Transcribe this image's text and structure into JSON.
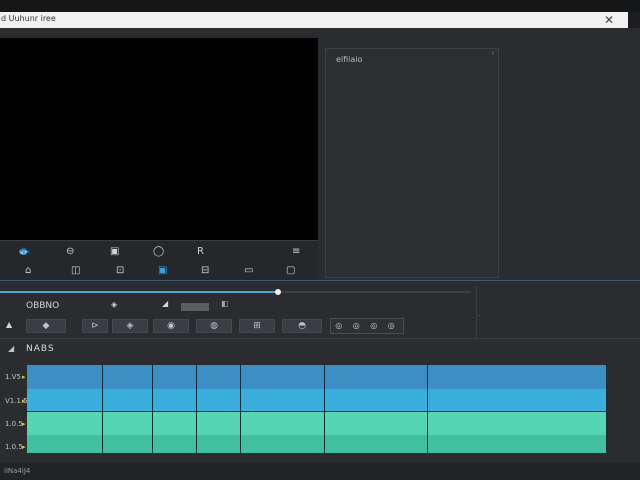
{
  "window": {
    "title": "d Uuhunr iree",
    "close_glyph": "✕"
  },
  "preview_controls": {
    "row1": [
      "🐟",
      "⊖",
      "▣",
      "◯",
      "R",
      "≡"
    ],
    "row2": [
      "⌂",
      "◫",
      "⊡",
      "▣",
      "⊟",
      "▭",
      "▢"
    ]
  },
  "props_panel": {
    "label": "eifiiaio",
    "corner_glyph": "ˀ"
  },
  "playback": {
    "progress_percent": 59
  },
  "toolbar": {
    "label": "OBBNO",
    "chip_glyph": "◈",
    "cursor_glyph": "◢",
    "chip2_glyph": "◧",
    "left_glyph": "▲"
  },
  "effects": [
    "◆",
    "⊳",
    "◈",
    "◉",
    "◍",
    "⊞",
    "◓"
  ],
  "effect_group": "◎ ◎ ◎ ◎",
  "timeline": {
    "icon": "◢",
    "label": "NABS",
    "tracks": [
      {
        "label": "1.V5",
        "color": "#3b8fc4"
      },
      {
        "label": "V1.1.5",
        "color": "#3aaedd"
      },
      {
        "label": "1.0.5",
        "color": "#54d6b3"
      },
      {
        "label": "1.0.5",
        "color": "#42bfa0"
      }
    ]
  },
  "status_bar": {
    "text": "iiNa4iJ4"
  }
}
